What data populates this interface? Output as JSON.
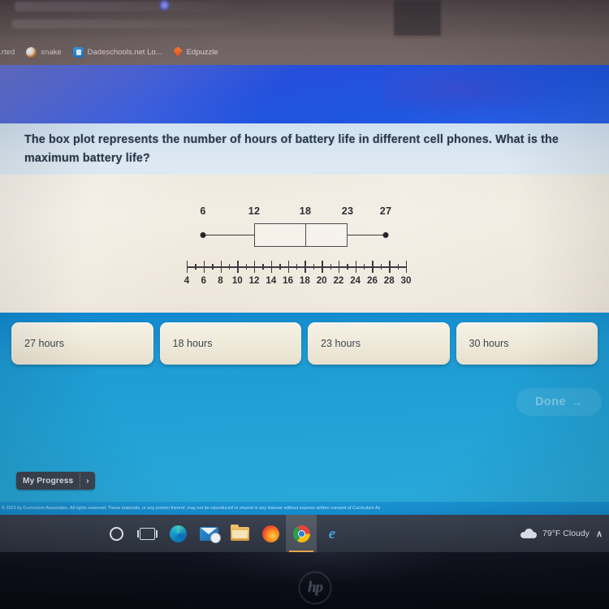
{
  "browser": {
    "bookmarks": [
      {
        "label": "...rted",
        "icon": "bookmark-icon"
      },
      {
        "label": "snake",
        "icon": "snake-favicon"
      },
      {
        "label": "Dadeschools.net Lo...",
        "icon": "dadeschools-favicon"
      },
      {
        "label": "Edpuzzle",
        "icon": "edpuzzle-favicon"
      }
    ]
  },
  "lesson": {
    "question": "The box plot represents the number of hours of battery life in different cell phones. What is the maximum battery life?",
    "answers": [
      {
        "label": "27 hours"
      },
      {
        "label": "18 hours"
      },
      {
        "label": "23 hours"
      },
      {
        "label": "30 hours"
      }
    ],
    "done_label": "Done",
    "done_arrow": "→",
    "progress_label": "My Progress",
    "progress_chevron": "›",
    "legal": "© 2021 by Curriculum Associates. All rights reserved. These materials, or any portion thereof, may not be reproduced or shared in any manner without express written consent of Curriculum As"
  },
  "chart_data": {
    "type": "box",
    "title": "",
    "xlabel": "",
    "ylabel": "",
    "xlim": [
      4,
      30
    ],
    "grid": false,
    "legend": "none",
    "box": {
      "min": 6,
      "q1": 12,
      "median": 18,
      "q3": 23,
      "max": 27
    },
    "value_labels": [
      "6",
      "12",
      "18",
      "23",
      "27"
    ],
    "axis_tick_labels": [
      "4",
      "6",
      "8",
      "10",
      "12",
      "14",
      "16",
      "18",
      "20",
      "22",
      "24",
      "26",
      "28",
      "30"
    ],
    "axis_major_ticks": [
      4,
      6,
      8,
      10,
      12,
      14,
      16,
      18,
      20,
      22,
      24,
      26,
      28,
      30
    ],
    "axis_minor_ticks": [
      5,
      7,
      9,
      11,
      13,
      15,
      17,
      19,
      21,
      23,
      25,
      27,
      29
    ]
  },
  "taskbar": {
    "items": [
      {
        "name": "cortana-icon"
      },
      {
        "name": "task-view-icon"
      },
      {
        "name": "edge-icon"
      },
      {
        "name": "mail-icon"
      },
      {
        "name": "file-explorer-icon"
      },
      {
        "name": "firefox-icon"
      },
      {
        "name": "chrome-icon"
      },
      {
        "name": "internet-explorer-icon"
      }
    ],
    "weather": "79°F  Cloudy",
    "chevron": "∧"
  },
  "device": {
    "brand": "hp"
  },
  "colors": {
    "app_blue": "#1f9ad3",
    "nav_blue": "#2450dd",
    "question_bg": "#d8e6f2",
    "card_cream": "#f0ead9",
    "taskbar": "#333a47"
  }
}
